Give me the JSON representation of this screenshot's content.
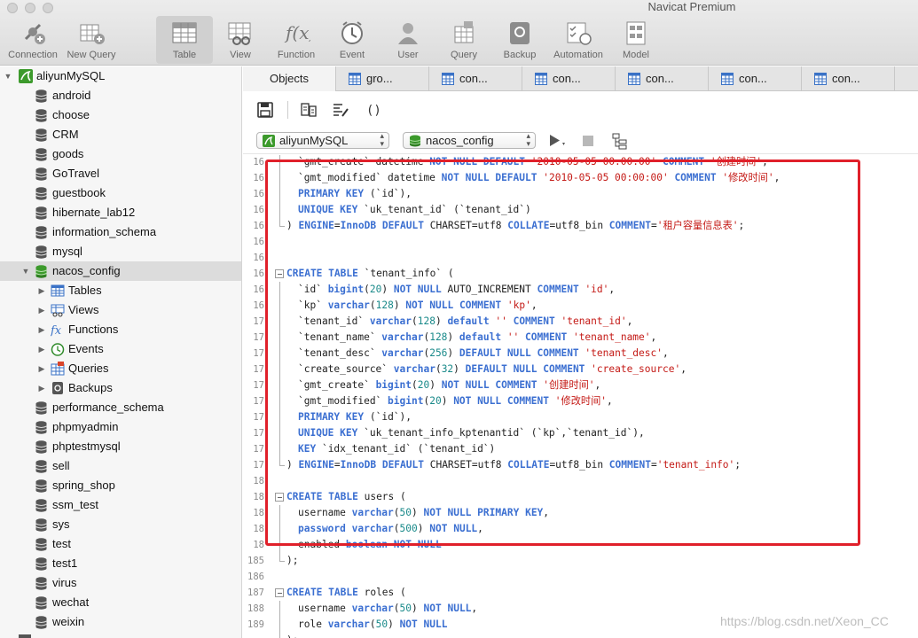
{
  "window": {
    "title": "Navicat Premium"
  },
  "toolbar": {
    "items": [
      {
        "label": "Connection",
        "icon": "connection-icon"
      },
      {
        "label": "New Query",
        "icon": "new-query-icon"
      },
      {
        "label": "Table",
        "icon": "table-icon"
      },
      {
        "label": "View",
        "icon": "view-icon"
      },
      {
        "label": "Function",
        "icon": "function-icon"
      },
      {
        "label": "Event",
        "icon": "event-icon"
      },
      {
        "label": "User",
        "icon": "user-icon"
      },
      {
        "label": "Query",
        "icon": "query-icon"
      },
      {
        "label": "Backup",
        "icon": "backup-icon"
      },
      {
        "label": "Automation",
        "icon": "automation-icon"
      },
      {
        "label": "Model",
        "icon": "model-icon"
      }
    ],
    "active": "Table"
  },
  "sidebar": {
    "connection": "aliyunMySQL",
    "databases": [
      "android",
      "choose",
      "CRM",
      "goods",
      "GoTravel",
      "guestbook",
      "hibernate_lab12",
      "information_schema",
      "mysql",
      "nacos_config"
    ],
    "expanded_db": "nacos_config",
    "children": [
      {
        "label": "Tables",
        "icon": "tables-icon"
      },
      {
        "label": "Views",
        "icon": "views-icon"
      },
      {
        "label": "Functions",
        "icon": "functions-icon"
      },
      {
        "label": "Events",
        "icon": "events-icon"
      },
      {
        "label": "Queries",
        "icon": "queries-icon"
      },
      {
        "label": "Backups",
        "icon": "backups-icon"
      }
    ],
    "databases_after": [
      "performance_schema",
      "phpmyadmin",
      "phptestmysql",
      "sell",
      "spring_shop",
      "ssm_test",
      "sys",
      "test",
      "test1",
      "virus",
      "wechat",
      "weixin"
    ]
  },
  "tabs": {
    "objects": "Objects",
    "items": [
      "gro...",
      "con...",
      "con...",
      "con...",
      "con...",
      "con..."
    ]
  },
  "query_bar": {
    "connection": "aliyunMySQL",
    "database": "nacos_config"
  },
  "editor": {
    "lines": [
      {
        "n": "16",
        "text": "`gmt_create` datetime NOT NULL DEFAULT '2010-05-05 00:00:00' COMMENT '创建时间',"
      },
      {
        "n": "16",
        "text": "`gmt_modified` datetime NOT NULL DEFAULT '2010-05-05 00:00:00' COMMENT '修改时间',"
      },
      {
        "n": "16",
        "text": "PRIMARY KEY (`id`),"
      },
      {
        "n": "16",
        "text": "UNIQUE KEY `uk_tenant_id` (`tenant_id`)"
      },
      {
        "n": "16",
        "text": ") ENGINE=InnoDB DEFAULT CHARSET=utf8 COLLATE=utf8_bin COMMENT='租户容量信息表';"
      },
      {
        "n": "16",
        "text": ""
      },
      {
        "n": "16",
        "text": ""
      },
      {
        "n": "16",
        "text": "CREATE TABLE `tenant_info` ("
      },
      {
        "n": "16",
        "text": "`id` bigint(20) NOT NULL AUTO_INCREMENT COMMENT 'id',"
      },
      {
        "n": "16",
        "text": "`kp` varchar(128) NOT NULL COMMENT 'kp',"
      },
      {
        "n": "17",
        "text": "`tenant_id` varchar(128) default '' COMMENT 'tenant_id',"
      },
      {
        "n": "17",
        "text": "`tenant_name` varchar(128) default '' COMMENT 'tenant_name',"
      },
      {
        "n": "17",
        "text": "`tenant_desc` varchar(256) DEFAULT NULL COMMENT 'tenant_desc',"
      },
      {
        "n": "17",
        "text": "`create_source` varchar(32) DEFAULT NULL COMMENT 'create_source',"
      },
      {
        "n": "17",
        "text": "`gmt_create` bigint(20) NOT NULL COMMENT '创建时间',"
      },
      {
        "n": "17",
        "text": "`gmt_modified` bigint(20) NOT NULL COMMENT '修改时间',"
      },
      {
        "n": "17",
        "text": "PRIMARY KEY (`id`),"
      },
      {
        "n": "17",
        "text": "UNIQUE KEY `uk_tenant_info_kptenantid` (`kp`,`tenant_id`),"
      },
      {
        "n": "17",
        "text": "KEY `idx_tenant_id` (`tenant_id`)"
      },
      {
        "n": "17",
        "text": ") ENGINE=InnoDB DEFAULT CHARSET=utf8 COLLATE=utf8_bin COMMENT='tenant_info';"
      },
      {
        "n": "18",
        "text": ""
      },
      {
        "n": "18",
        "text": "CREATE TABLE users ("
      },
      {
        "n": "18",
        "text": "username varchar(50) NOT NULL PRIMARY KEY,"
      },
      {
        "n": "18",
        "text": "password varchar(500) NOT NULL,"
      },
      {
        "n": "18",
        "text": "enabled boolean NOT NULL"
      },
      {
        "n": "185",
        "text": ");"
      },
      {
        "n": "186",
        "text": ""
      },
      {
        "n": "187",
        "text": "CREATE TABLE roles ("
      },
      {
        "n": "188",
        "text": "username varchar(50) NOT NULL,"
      },
      {
        "n": "189",
        "text": "role varchar(50) NOT NULL"
      },
      {
        "n": "",
        "text": ");"
      }
    ]
  },
  "watermark": "https://blog.csdn.net/Xeon_CC",
  "colors": {
    "keyword": "#3b6fd1",
    "string": "#c41a16",
    "number": "#1a8a8a",
    "highlight_border": "#e0202a",
    "connection_green": "#3c9a2c"
  }
}
